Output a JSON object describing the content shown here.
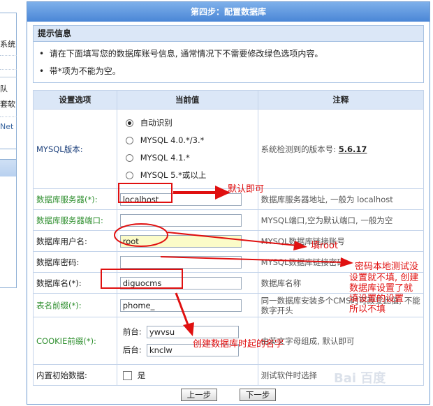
{
  "sidebar_fragments": [
    "系统",
    "队",
    "套软",
    "Net"
  ],
  "panel_title": "第四步：配置数据库",
  "tips": {
    "heading": "提示信息",
    "items": [
      "请在下面填写您的数据库账号信息, 通常情况下不需要修改绿色选项内容。",
      "带*项为不能为空。"
    ]
  },
  "table": {
    "headers": [
      "设置选项",
      "当前值",
      "注释"
    ],
    "mysql_version": {
      "label": "MYSQL版本:",
      "options": [
        "自动识别",
        "MYSQL 4.0.*/3.*",
        "MYSQL 4.1.*",
        "MYSQL 5.*或以上"
      ],
      "selected": "自动识别",
      "note_prefix": "系统检测到的版本号:",
      "detected_version": "5.6.17"
    },
    "rows": [
      {
        "label": "数据库服务器(*):",
        "value": "localhost",
        "note": "数据库服务器地址, 一般为 localhost"
      },
      {
        "label": "数据库服务器端口:",
        "value": "",
        "note": "MYSQL端口,空为默认端口, 一般为空"
      },
      {
        "label": "数据库用户名:",
        "value": "root",
        "note": "MYSQL数据库链接账号"
      },
      {
        "label": "数据库密码:",
        "value": "",
        "note": "MYSQL数据库链接密码"
      },
      {
        "label": "数据库名(*):",
        "value": "diguocms",
        "note": "数据库名称"
      },
      {
        "label": "表名前缀(*):",
        "value": "phome_",
        "note": "同一数据库安装多个CMS时可改变此值, 不能数字开头"
      }
    ],
    "cookie": {
      "label": "COOKIE前缀(*):",
      "front_label": "前台:",
      "front_value": "ywvsu",
      "back_label": "后台:",
      "back_value": "knclw",
      "note": "由英文字母组成, 默认即可"
    },
    "builtin": {
      "label": "内置初始数据:",
      "checkbox_label": "是",
      "checked": false,
      "note": "测试软件时选择"
    }
  },
  "buttons": {
    "prev": "上一步",
    "next": "下一步"
  },
  "annotations": {
    "default_ok": "默认即可",
    "fill_root": "填root",
    "password_note": [
      "密码本地测试没",
      "设置就不填, 创建",
      "数据库设置了就",
      "填设置的设置",
      "所以不填"
    ],
    "dbname_note": "创建数据库时起的名字"
  },
  "watermark": "Bai 百度",
  "colors": {
    "annotation_red": "#e01010",
    "title_blue": "#4a86d6",
    "header_bg": "#dbe7f7",
    "green_label": "#2f8f2f"
  }
}
